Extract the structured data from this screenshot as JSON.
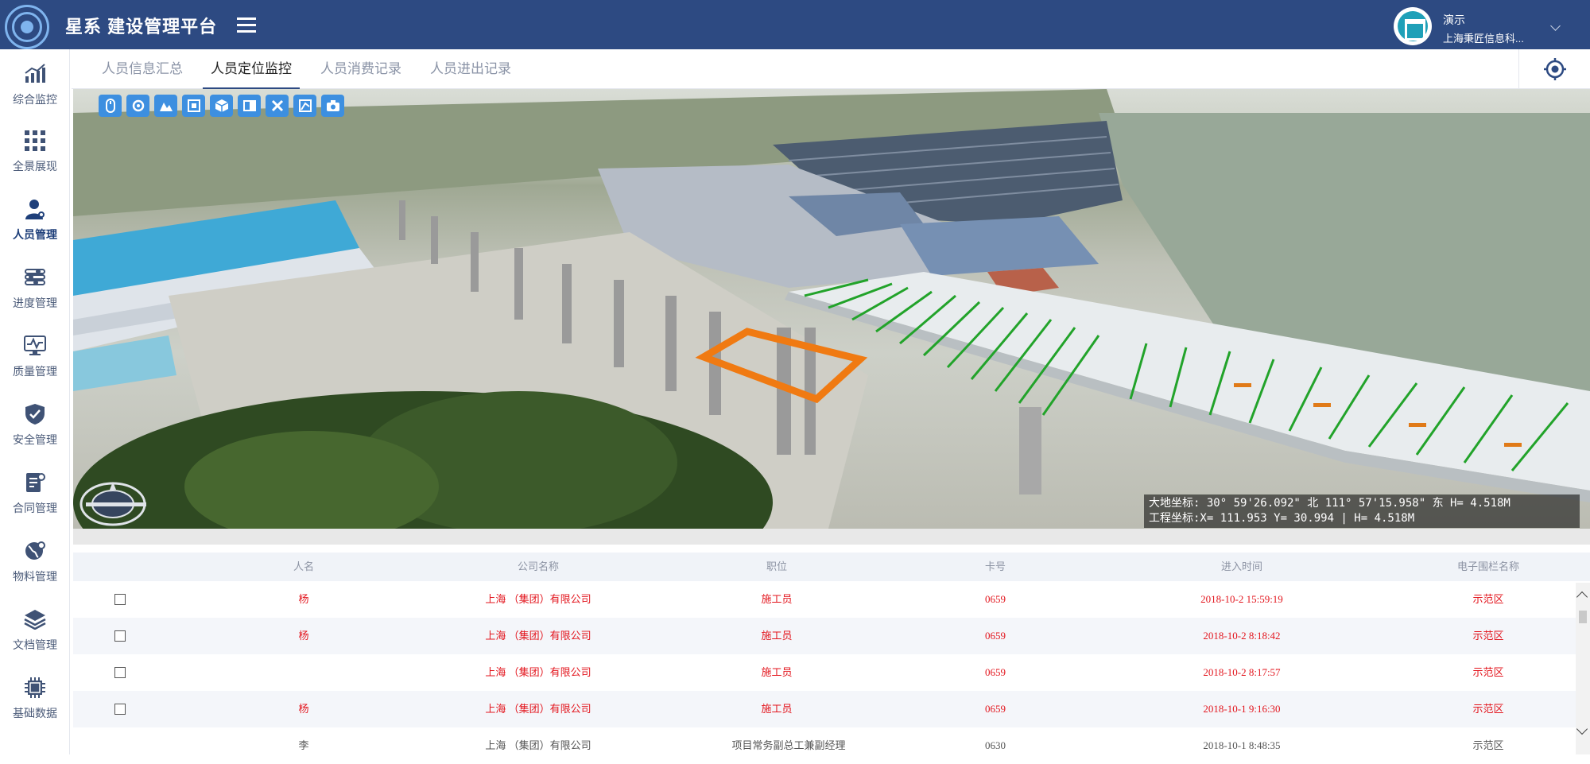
{
  "header": {
    "app_title": "星系 建设管理平台",
    "user_name": "演示",
    "user_org": "上海秉匠信息科..."
  },
  "sidebar": {
    "items": [
      {
        "label": "综合监控",
        "icon": "chart-icon"
      },
      {
        "label": "全景展现",
        "icon": "grid-icon"
      },
      {
        "label": "人员管理",
        "icon": "person-icon",
        "active": true
      },
      {
        "label": "进度管理",
        "icon": "sliders-icon"
      },
      {
        "label": "质量管理",
        "icon": "monitor-icon"
      },
      {
        "label": "安全管理",
        "icon": "shield-icon"
      },
      {
        "label": "合同管理",
        "icon": "document-icon"
      },
      {
        "label": "物料管理",
        "icon": "globe-icon"
      },
      {
        "label": "文档管理",
        "icon": "layers-icon"
      },
      {
        "label": "基础数据",
        "icon": "chip-icon"
      }
    ]
  },
  "tabs": [
    {
      "label": "人员信息汇总"
    },
    {
      "label": "人员定位监控",
      "active": true
    },
    {
      "label": "人员消费记录"
    },
    {
      "label": "人员进出记录"
    }
  ],
  "viewport": {
    "toolbar_icons": [
      "mouse-icon",
      "rotate-icon",
      "terrain-icon",
      "frame-icon",
      "cube-icon",
      "split-icon",
      "close-x-icon",
      "measure-icon",
      "camera-icon"
    ],
    "coord_line1": "大地坐标: 30° 59'26.092\" 北  111° 57'15.958\" 东  H=  4.518M",
    "coord_line2": "工程坐标:X=      111.953  Y=       30.994 | H=  4.518M"
  },
  "table": {
    "columns": [
      "人名",
      "公司名称",
      "职位",
      "卡号",
      "进入时间",
      "电子围栏名称"
    ],
    "rows": [
      {
        "name": "杨",
        "company": "上海           （集团）有限公司",
        "position": "施工员",
        "card": "0659",
        "time": "2018-10-2 15:59:19",
        "fence": "示范区"
      },
      {
        "name": "杨",
        "company": "上海           （集团）有限公司",
        "position": "施工员",
        "card": "0659",
        "time": "2018-10-2 8:18:42",
        "fence": "示范区"
      },
      {
        "name": "",
        "company": "上海           （集团）有限公司",
        "position": "施工员",
        "card": "0659",
        "time": "2018-10-2 8:17:57",
        "fence": "示范区"
      },
      {
        "name": "杨",
        "company": "上海           （集团）有限公司",
        "position": "施工员",
        "card": "0659",
        "time": "2018-10-1 9:16:30",
        "fence": "示范区"
      },
      {
        "name": "李",
        "company": "上海           （集团）有限公司",
        "position": "项目常务副总工兼副经理",
        "card": "0630",
        "time": "2018-10-1 8:48:35",
        "fence": "示范区"
      }
    ]
  },
  "colors": {
    "header_bg": "#2d4a82",
    "toolbar_btn": "#3d8fe0",
    "row_text": "#e3161e",
    "bridge_rail": "#22a32a",
    "fence_orange": "#f07a12"
  }
}
